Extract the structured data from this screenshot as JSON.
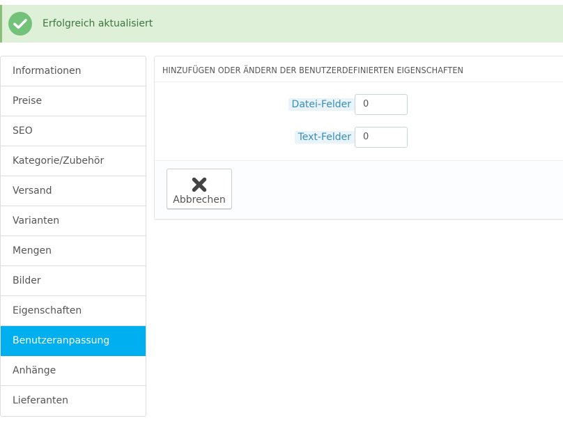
{
  "alert": {
    "message": "Erfolgreich aktualisiert",
    "icon": "check-icon",
    "color": "#72c279"
  },
  "sidebar": {
    "active_color": "#00aff0",
    "items": [
      {
        "label": "Informationen"
      },
      {
        "label": "Preise"
      },
      {
        "label": "SEO"
      },
      {
        "label": "Kategorie/Zubehör"
      },
      {
        "label": "Versand"
      },
      {
        "label": "Varianten"
      },
      {
        "label": "Mengen"
      },
      {
        "label": "Bilder"
      },
      {
        "label": "Eigenschaften"
      },
      {
        "label": "Benutzeranpassung",
        "active": true
      },
      {
        "label": "Anhänge"
      },
      {
        "label": "Lieferanten"
      }
    ]
  },
  "panel": {
    "title": "HINZUFÜGEN ODER ÄNDERN DER BENUTZERDEFINIERTEN EIGENSCHAFTEN",
    "fields": [
      {
        "label": "Datei-Felder",
        "value": "0"
      },
      {
        "label": "Text-Felder",
        "value": "0"
      }
    ],
    "cancel_label": "Abbrechen",
    "cancel_icon": "close-icon"
  }
}
